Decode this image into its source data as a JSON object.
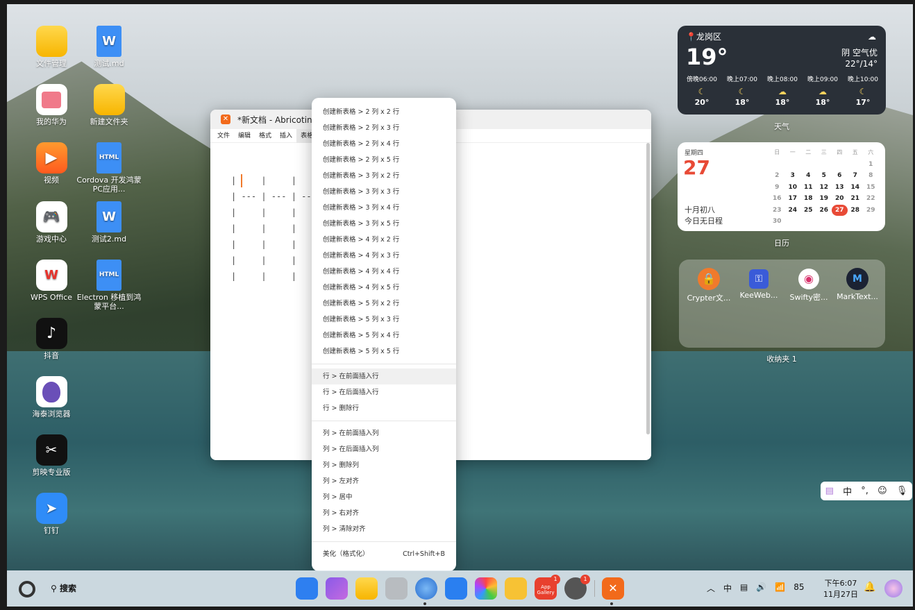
{
  "desktop": {
    "icons": [
      {
        "label": "文件管理"
      },
      {
        "label": "我的华为"
      },
      {
        "label": "视频"
      },
      {
        "label": "游戏中心"
      },
      {
        "label": "WPS Office"
      },
      {
        "label": "抖音"
      },
      {
        "label": "海泰浏览器"
      },
      {
        "label": "剪映专业版"
      },
      {
        "label": "钉钉"
      },
      {
        "label": "测试.md"
      },
      {
        "label": "新建文件夹"
      },
      {
        "label": "Cordova 开发鸿蒙PC应用..."
      },
      {
        "label": "测试2.md"
      },
      {
        "label": "Electron 移植到鸿蒙平台..."
      }
    ]
  },
  "weather": {
    "location": "龙岗区",
    "temp": "19°",
    "condition": "阴 空气优",
    "range": "22°/14°",
    "forecast": [
      {
        "time": "傍晚06:00",
        "icon": "☾",
        "temp": "20°"
      },
      {
        "time": "晚上07:00",
        "icon": "☾",
        "temp": "18°"
      },
      {
        "time": "晚上08:00",
        "icon": "☁",
        "temp": "18°"
      },
      {
        "time": "晚上09:00",
        "icon": "☁",
        "temp": "18°"
      },
      {
        "time": "晚上10:00",
        "icon": "☾",
        "temp": "17°"
      }
    ],
    "widget_label": "天气"
  },
  "calendar": {
    "weekday": "星期四",
    "day": "27",
    "lunar": "十月初八",
    "schedule": "今日无日程",
    "widget_label": "日历",
    "headers": [
      "日",
      "一",
      "二",
      "三",
      "四",
      "五",
      "六"
    ],
    "weeks": [
      [
        "",
        "",
        "",
        "",
        "",
        "",
        "1"
      ],
      [
        "2",
        "3",
        "4",
        "5",
        "6",
        "7",
        "8"
      ],
      [
        "9",
        "10",
        "11",
        "12",
        "13",
        "14",
        "15"
      ],
      [
        "16",
        "17",
        "18",
        "19",
        "20",
        "21",
        "22"
      ],
      [
        "23",
        "24",
        "25",
        "26",
        "27",
        "28",
        "29"
      ],
      [
        "30",
        "",
        "",
        "",
        "",
        "",
        ""
      ]
    ],
    "today": "27"
  },
  "folder": {
    "apps": [
      "Crypter文...",
      "KeeWeb...",
      "Swifty密...",
      "MarkText..."
    ],
    "widget_label": "收纳夹 1"
  },
  "editor": {
    "title": "*新文档 - Abricotin",
    "menu": [
      "文件",
      "编辑",
      "格式",
      "插入",
      "表格"
    ],
    "lines": [
      "|     |     |   ",
      "| --- | --- | --",
      "|     |     |   ",
      "|     |     |   ",
      "|     |     |   ",
      "|     |     |   ",
      "|     |     |   "
    ]
  },
  "context_menu": {
    "groups": [
      [
        "创建新表格 > 2 列 x 2 行",
        "创建新表格 > 2 列 x 3 行",
        "创建新表格 > 2 列 x 4 行",
        "创建新表格 > 2 列 x 5 行",
        "创建新表格 > 3 列 x 2 行",
        "创建新表格 > 3 列 x 3 行",
        "创建新表格 > 3 列 x 4 行",
        "创建新表格 > 3 列 x 5 行",
        "创建新表格 > 4 列 x 2 行",
        "创建新表格 > 4 列 x 3 行",
        "创建新表格 > 4 列 x 4 行",
        "创建新表格 > 4 列 x 5 行",
        "创建新表格 > 5 列 x 2 行",
        "创建新表格 > 5 列 x 3 行",
        "创建新表格 > 5 列 x 4 行",
        "创建新表格 > 5 列 x 5 行"
      ],
      [
        "行 > 在前面插入行",
        "行 > 在后面插入行",
        "行 > 删除行"
      ],
      [
        "列 > 在前面插入列",
        "列 > 在后面插入列",
        "列 > 删除列",
        "列 > 左对齐",
        "列 > 居中",
        "列 > 右对齐",
        "列 > 清除对齐"
      ],
      [
        "美化（格式化）"
      ]
    ],
    "hovered": "行 > 在前面插入行",
    "shortcut_beautify": "Ctrl+Shift+B"
  },
  "ime": {
    "mode": "中",
    "punct": "°,"
  },
  "taskbar": {
    "search_label": "搜索",
    "appgallery_label": "App Gallery",
    "appgallery_badge": "1",
    "settings_badge": "1",
    "battery": "85",
    "time": "下午6:07",
    "date": "11月27日"
  }
}
